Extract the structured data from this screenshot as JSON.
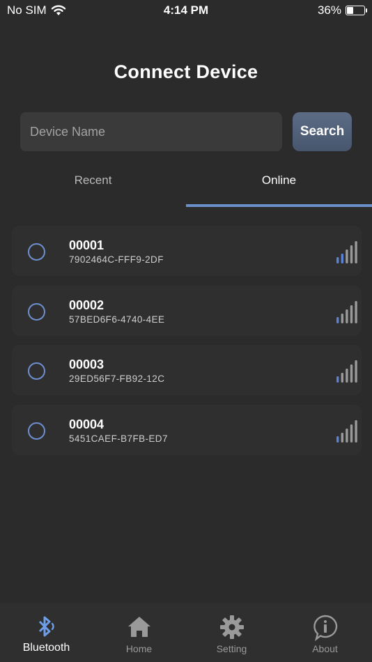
{
  "status_bar": {
    "carrier": "No SIM",
    "time": "4:14 PM",
    "battery_percent": "36%",
    "battery_level": 0.36
  },
  "title": "Connect Device",
  "search": {
    "placeholder": "Device Name",
    "value": "",
    "button_label": "Search"
  },
  "tabs": [
    {
      "label": "Recent",
      "active": false
    },
    {
      "label": "Online",
      "active": true
    }
  ],
  "devices": [
    {
      "name": "00001",
      "id": "7902464C-FFF9-2DF",
      "signal_bars": 2
    },
    {
      "name": "00002",
      "id": "57BED6F6-4740-4EE",
      "signal_bars": 1
    },
    {
      "name": "00003",
      "id": "29ED56F7-FB92-12C",
      "signal_bars": 1
    },
    {
      "name": "00004",
      "id": "5451CAEF-B7FB-ED7",
      "signal_bars": 1
    }
  ],
  "tab_bar": [
    {
      "label": "Bluetooth",
      "icon": "bluetooth-icon",
      "active": true
    },
    {
      "label": "Home",
      "icon": "home-icon",
      "active": false
    },
    {
      "label": "Setting",
      "icon": "gear-icon",
      "active": false
    },
    {
      "label": "About",
      "icon": "info-icon",
      "active": false
    }
  ],
  "colors": {
    "background": "#2b2b2b",
    "accent": "#6e8fcf",
    "signal_active": "#5b82d6",
    "signal_inactive": "#9a9a9a"
  }
}
